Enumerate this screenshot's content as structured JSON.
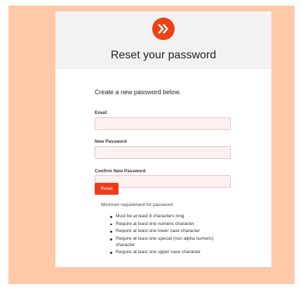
{
  "brand": {
    "accent": "#ee4213",
    "background": "#ffc9a8",
    "logo_icon": "double-chevron-right-icon"
  },
  "page": {
    "title": "Reset your password",
    "intro": "Create a new password below."
  },
  "form": {
    "email_label": "Email",
    "email_value": "",
    "new_password_label": "New Password",
    "new_password_value": "",
    "confirm_password_label": "Confirm New Password",
    "confirm_password_value": "",
    "reset_label": "Reset"
  },
  "requirements": {
    "heading": "Minimum requirement for password:",
    "items": [
      "Must be at least 8 characters long",
      "Require at least one numeric character",
      "Require at least one lower case character",
      "Require at least one special (non alpha numeric) character",
      "Require at least one upper case character"
    ]
  }
}
